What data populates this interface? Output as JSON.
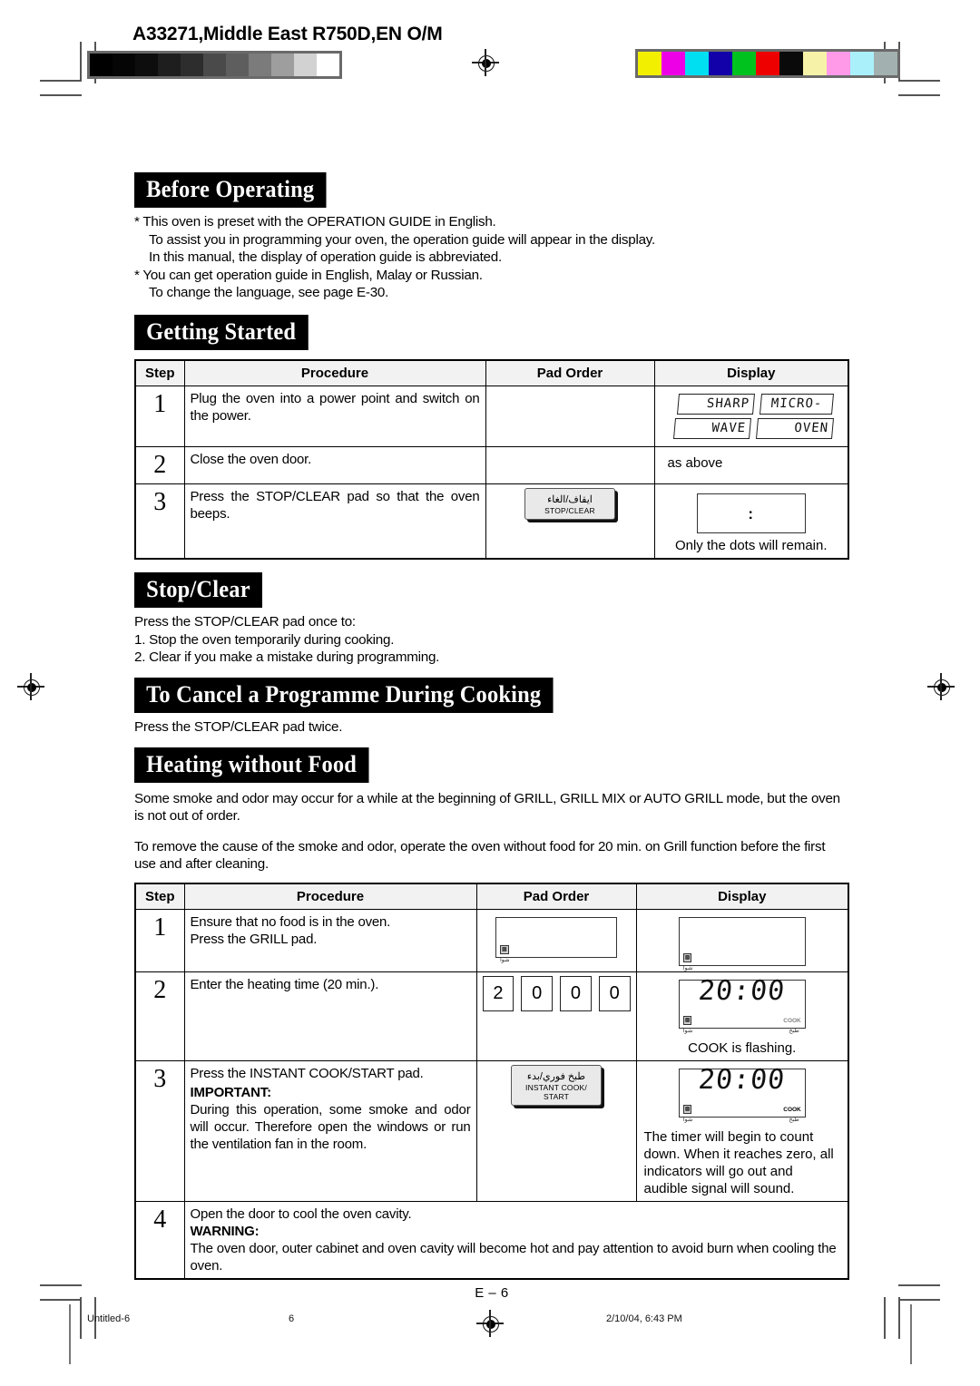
{
  "header": {
    "doc_code": "A33271,Middle East R750D,EN O/M",
    "greyscale_wedge": [
      "#000000",
      "#050505",
      "#0d0d0d",
      "#1e1e1e",
      "#2d2d2d",
      "#4a4a4a",
      "#5e5e5e",
      "#7b7b7b",
      "#9e9e9e",
      "#d2d2d2",
      "#ffffff"
    ],
    "colorbar": [
      "#f2f000",
      "#ee00e6",
      "#00dff2",
      "#1200a8",
      "#00c21e",
      "#ee0000",
      "#0a0a0a",
      "#f6f2a8",
      "#ff9ae8",
      "#aaf0fb",
      "#a3b0b0"
    ]
  },
  "sections": {
    "before_operating": {
      "title": "Before Operating",
      "lines": [
        "*  This oven is preset with the OPERATION GUIDE in English.",
        "To assist you in programming your oven, the operation guide will appear in the display.",
        "In this manual, the display of operation guide is abbreviated.",
        "*  You can get operation guide in English, Malay or Russian.",
        "To change the language, see page E-30."
      ]
    },
    "getting_started": {
      "title": "Getting Started",
      "table": {
        "headers": [
          "Step",
          "Procedure",
          "Pad Order",
          "Display"
        ],
        "rows": [
          {
            "step": "1",
            "procedure": "Plug the oven into a power point and switch on the power.",
            "pad": "",
            "display_lcd": [
              "SHARP",
              "MICRO-",
              "WAVE",
              "OVEN"
            ],
            "display_note": ""
          },
          {
            "step": "2",
            "procedure": "Close the oven door.",
            "pad": "",
            "display_text": "as above"
          },
          {
            "step": "3",
            "procedure": "Press the STOP/CLEAR pad so that the oven beeps.",
            "pad_key": {
              "arabic": "ايقاف/الغاء",
              "english": "STOP/CLEAR"
            },
            "display_dots": ":",
            "display_note": "Only the dots will remain."
          }
        ]
      }
    },
    "stop_clear": {
      "title": "Stop/Clear",
      "lead": "Press the STOP/CLEAR pad once to:",
      "items": [
        "1.  Stop the oven temporarily during cooking.",
        "2.  Clear if you make a mistake during programming."
      ]
    },
    "cancel_programme": {
      "title": "To Cancel a Programme During Cooking",
      "body": "Press the STOP/CLEAR pad twice."
    },
    "heating_without_food": {
      "title": "Heating without Food",
      "paragraphs": [
        "Some smoke and odor may occur for a while at the beginning of GRILL, GRILL MIX or AUTO GRILL mode, but the oven is not out of order.",
        "To remove the cause of the smoke and odor, operate the oven without food for 20 min. on Grill function before the first use and after cleaning."
      ],
      "table": {
        "headers": [
          "Step",
          "Procedure",
          "Pad Order",
          "Display"
        ],
        "rows": [
          {
            "step": "1",
            "procedure_lines": [
              "Ensure that no food is in the oven.",
              "Press the GRILL pad."
            ],
            "pad_blank": true,
            "display_blank": true,
            "display_note": ""
          },
          {
            "step": "2",
            "procedure_lines": [
              "Enter the heating time (20 min.)."
            ],
            "pad_numbers": [
              "2",
              "0",
              "0",
              "0"
            ],
            "display_value": "20:00",
            "display_cook_label": "COOK",
            "display_cook_flashing": true,
            "display_note": "COOK is flashing."
          },
          {
            "step": "3",
            "procedure_lines": [
              "Press the INSTANT COOK/START pad."
            ],
            "procedure_important_label": "IMPORTANT:",
            "procedure_important_body": "During this operation, some smoke and odor will occur. Therefore open the windows or run the ventilation fan in the room.",
            "pad_key": {
              "arabic": "طبخ فوري/بدء",
              "english_line1": "INSTANT COOK/",
              "english_line2": "START"
            },
            "display_value": "20:00",
            "display_cook_label": "COOK",
            "display_cook_flashing": false,
            "display_note": "The timer will begin to count down. When it reaches zero, all indicators will go out and audible signal will sound."
          },
          {
            "step": "4",
            "procedure_lines": [
              "Open the door to cool the oven cavity."
            ],
            "procedure_warning_label": "WARNING:",
            "procedure_warning_body": "The oven door, outer cabinet and oven cavity will become hot and pay attention to avoid burn when cooling the oven."
          }
        ]
      }
    }
  },
  "page_number": "E – 6",
  "footer": {
    "file_name": "Untitled-6",
    "page": "6",
    "timestamp": "2/10/04, 6:43 PM"
  }
}
